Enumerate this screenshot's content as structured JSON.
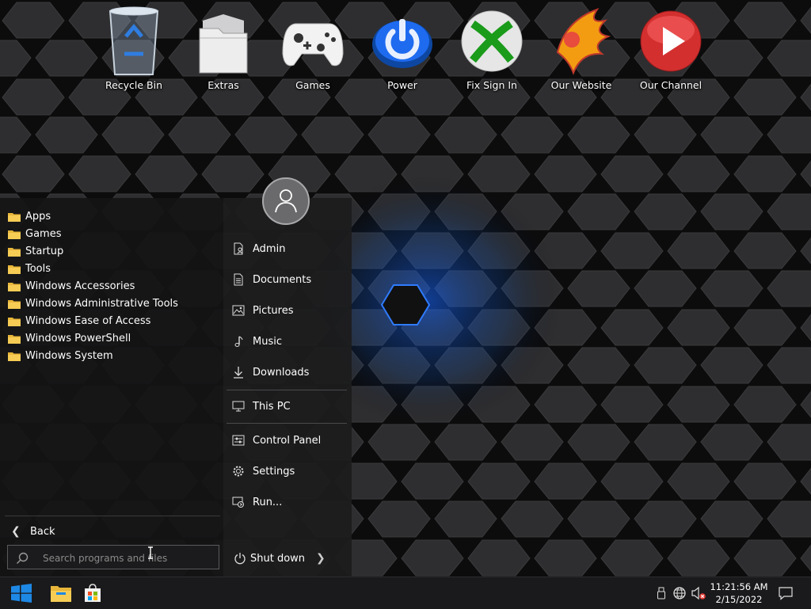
{
  "desktop": {
    "icons": [
      {
        "id": "recycle-bin",
        "label": "Recycle Bin",
        "icon": "recycle-bin-icon"
      },
      {
        "id": "extras",
        "label": "Extras",
        "icon": "folder-stack-icon"
      },
      {
        "id": "games",
        "label": "Games",
        "icon": "gamepad-icon"
      },
      {
        "id": "power",
        "label": "Power",
        "icon": "power-icon"
      },
      {
        "id": "fix-sign-in",
        "label": "Fix Sign In",
        "icon": "xbox-icon"
      },
      {
        "id": "our-website",
        "label": "Our Website",
        "icon": "phoenix-icon"
      },
      {
        "id": "our-channel",
        "label": "Our Channel",
        "icon": "play-icon"
      }
    ]
  },
  "start_menu": {
    "programs": [
      "Apps",
      "Games",
      "Startup",
      "Tools",
      "Windows Accessories",
      "Windows Administrative Tools",
      "Windows Ease of Access",
      "Windows PowerShell",
      "Windows System"
    ],
    "back_label": "Back",
    "search_placeholder": "Search programs and files",
    "right_items": {
      "admin": "Admin",
      "documents": "Documents",
      "pictures": "Pictures",
      "music": "Music",
      "downloads": "Downloads",
      "this_pc": "This PC",
      "control_panel": "Control Panel",
      "settings": "Settings",
      "run": "Run..."
    },
    "shutdown_label": "Shut down"
  },
  "taskbar": {
    "time": "11:21:56 AM",
    "date": "2/15/2022",
    "accent_color": "#1e88e5"
  }
}
